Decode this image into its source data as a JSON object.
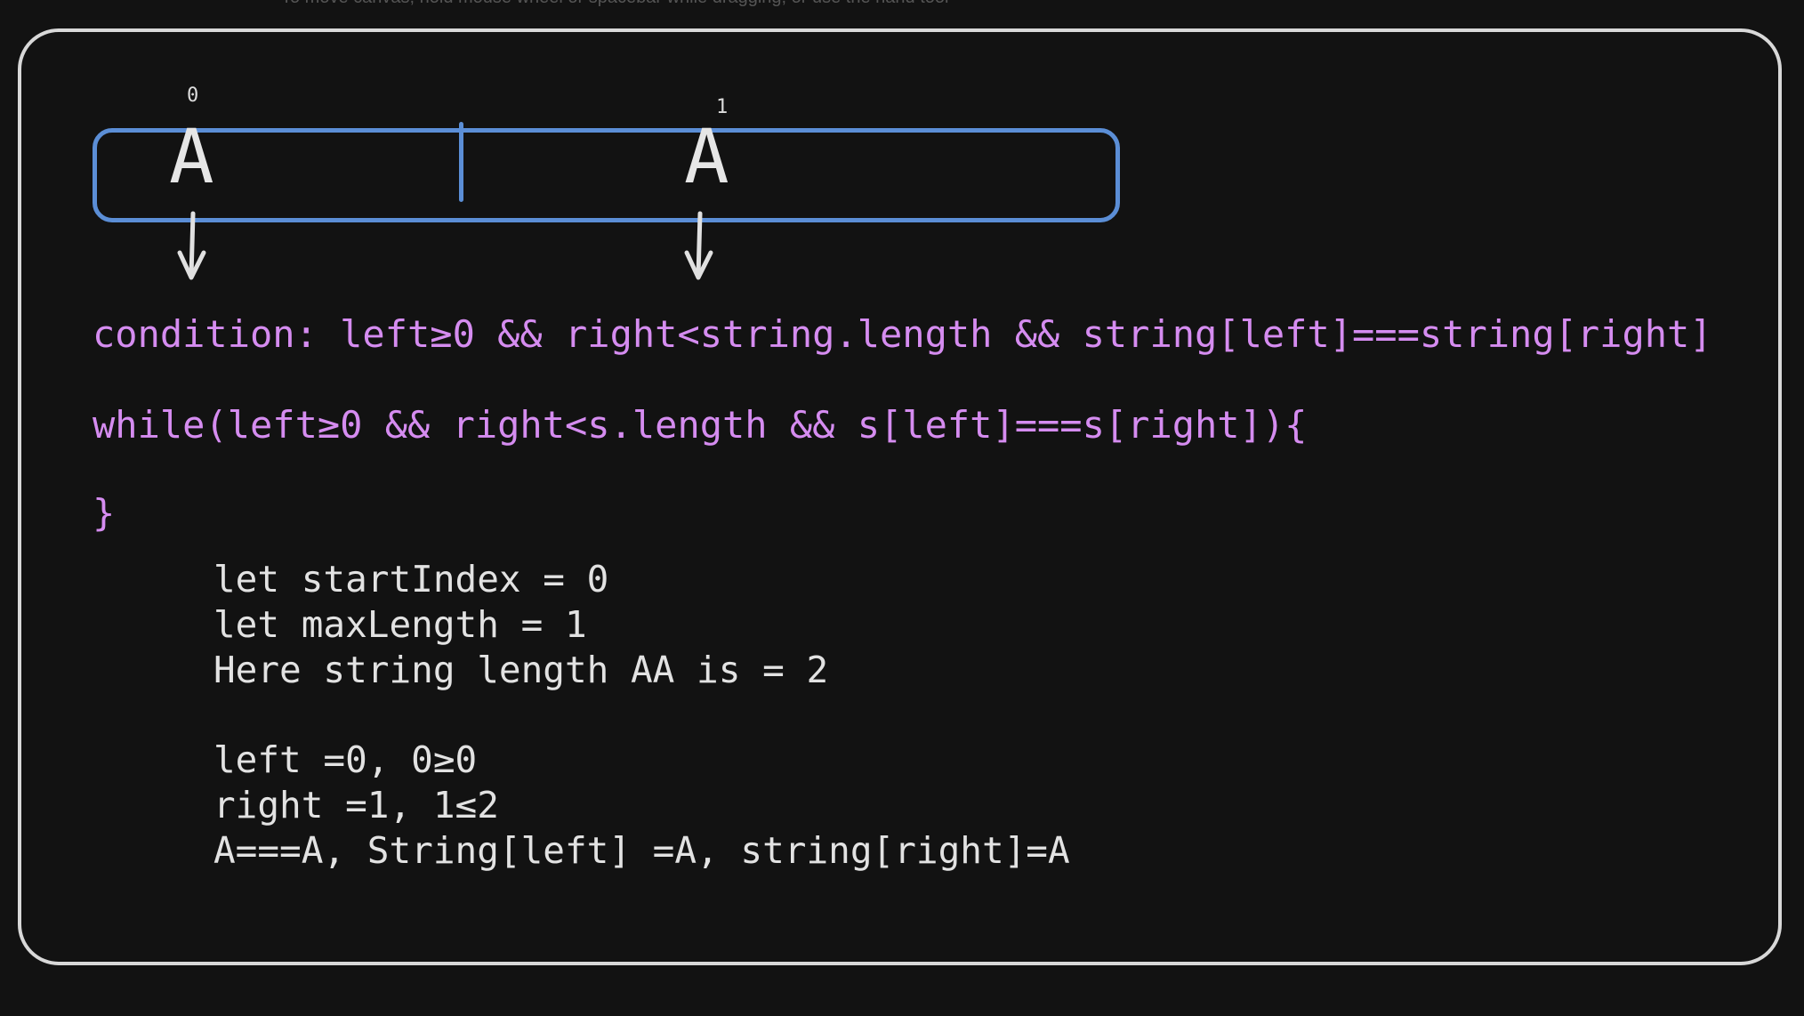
{
  "hint_text": "To move canvas, hold mouse wheel or spacebar while dragging, or use the hand tool",
  "array": {
    "cells": [
      {
        "index": "0",
        "char": "A"
      },
      {
        "index": "1",
        "char": "A"
      }
    ]
  },
  "purple_lines": {
    "condition": "condition: left≥0 && right<string.length && string[left]===string[right]",
    "while_open": "while(left≥0 && right<s.length && s[left]===s[right]){",
    "while_close": "}"
  },
  "code_lines": [
    "let startIndex = 0",
    "let maxLength = 1",
    "Here string length AA is = 2",
    "left =0, 0≥0",
    "right =1, 1≤2",
    "A===A, String[left] =A, string[right]=A"
  ],
  "colors": {
    "background": "#121212",
    "frame": "#d8d8d8",
    "array_box": "#5b8ed6",
    "purple_text": "#d58cf0",
    "white_text": "#e2e2e2"
  }
}
